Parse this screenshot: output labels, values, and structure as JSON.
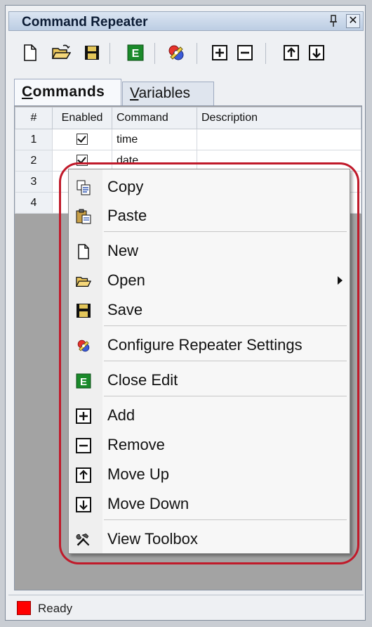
{
  "window": {
    "title": "Command Repeater"
  },
  "toolbar": {
    "buttons": [
      {
        "icon": "new-file-icon"
      },
      {
        "icon": "open-folder-icon"
      },
      {
        "icon": "save-icon"
      },
      {
        "icon": "close-edit-icon"
      },
      {
        "icon": "settings-icon"
      },
      {
        "icon": "add-icon"
      },
      {
        "icon": "remove-icon"
      },
      {
        "icon": "move-up-icon"
      },
      {
        "icon": "move-down-icon"
      }
    ]
  },
  "tabs": {
    "commands_first": "C",
    "commands_rest": "ommands",
    "variables_first": "V",
    "variables_rest": "ariables"
  },
  "table": {
    "headers": [
      "#",
      "Enabled",
      "Command",
      "Description"
    ],
    "rows": [
      {
        "num": "1",
        "enabled": true,
        "command": "time",
        "description": ""
      },
      {
        "num": "2",
        "enabled": true,
        "command": "date",
        "description": ""
      },
      {
        "num": "3",
        "enabled": false,
        "command": "",
        "description": ""
      },
      {
        "num": "4",
        "enabled": false,
        "command": "",
        "description": ""
      }
    ]
  },
  "context_menu": {
    "items": [
      {
        "label": "Copy",
        "icon": "copy-icon"
      },
      {
        "label": "Paste",
        "icon": "paste-icon"
      },
      {
        "label": "New",
        "icon": "new-file-icon"
      },
      {
        "label": "Open",
        "icon": "open-folder-icon",
        "submenu": true
      },
      {
        "label": "Save",
        "icon": "save-icon"
      },
      {
        "label": "Configure Repeater Settings",
        "icon": "settings-icon"
      },
      {
        "label": "Close Edit",
        "icon": "close-edit-icon"
      },
      {
        "label": "Add",
        "icon": "add-icon"
      },
      {
        "label": "Remove",
        "icon": "remove-icon"
      },
      {
        "label": "Move Up",
        "icon": "move-up-icon"
      },
      {
        "label": "Move Down",
        "icon": "move-down-icon"
      },
      {
        "label": "View Toolbox",
        "icon": "toolbox-icon"
      }
    ]
  },
  "status": {
    "text": "Ready",
    "indicator_color": "#ff0000"
  },
  "colors": {
    "highlight_ring": "#c01a2a",
    "close_edit_green": "#1a8a2a"
  }
}
